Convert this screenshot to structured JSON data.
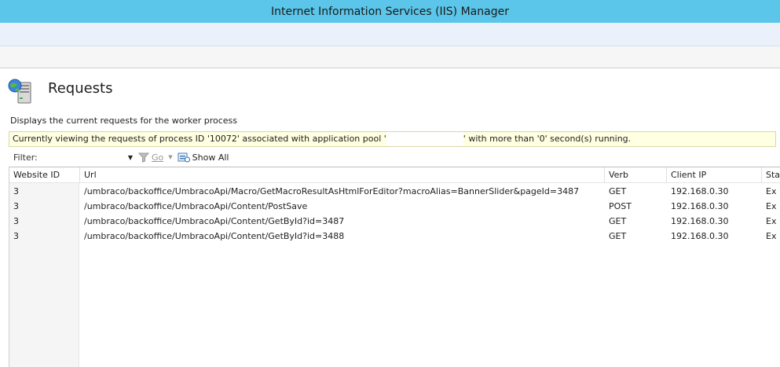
{
  "window": {
    "title": "Internet Information Services (IIS) Manager"
  },
  "page": {
    "title": "Requests",
    "icon": "server-globe-icon",
    "description": "Displays the current requests for the worker process"
  },
  "banner": {
    "text_before": "Currently viewing the requests of process ID '10072' associated with application pool '",
    "text_after": "' with more than '0' second(s) running."
  },
  "toolbar": {
    "filter_label": "Filter:",
    "go_label": "Go",
    "show_all_label": "Show All"
  },
  "table": {
    "columns": [
      "Website ID",
      "Url",
      "Verb",
      "Client IP",
      "Sta"
    ],
    "rows": [
      [
        "3",
        "/umbraco/backoffice/UmbracoApi/Macro/GetMacroResultAsHtmlForEditor?macroAlias=BannerSlider&pageId=3487",
        "GET",
        "192.168.0.30",
        "Ex"
      ],
      [
        "3",
        "/umbraco/backoffice/UmbracoApi/Content/PostSave",
        "POST",
        "192.168.0.30",
        "Ex"
      ],
      [
        "3",
        "/umbraco/backoffice/UmbracoApi/Content/GetById?id=3487",
        "GET",
        "192.168.0.30",
        "Ex"
      ],
      [
        "3",
        "/umbraco/backoffice/UmbracoApi/Content/GetById?id=3488",
        "GET",
        "192.168.0.30",
        "Ex"
      ]
    ]
  },
  "colors": {
    "titlebar": "#5bc6ea",
    "banner": "#ffffe1"
  }
}
